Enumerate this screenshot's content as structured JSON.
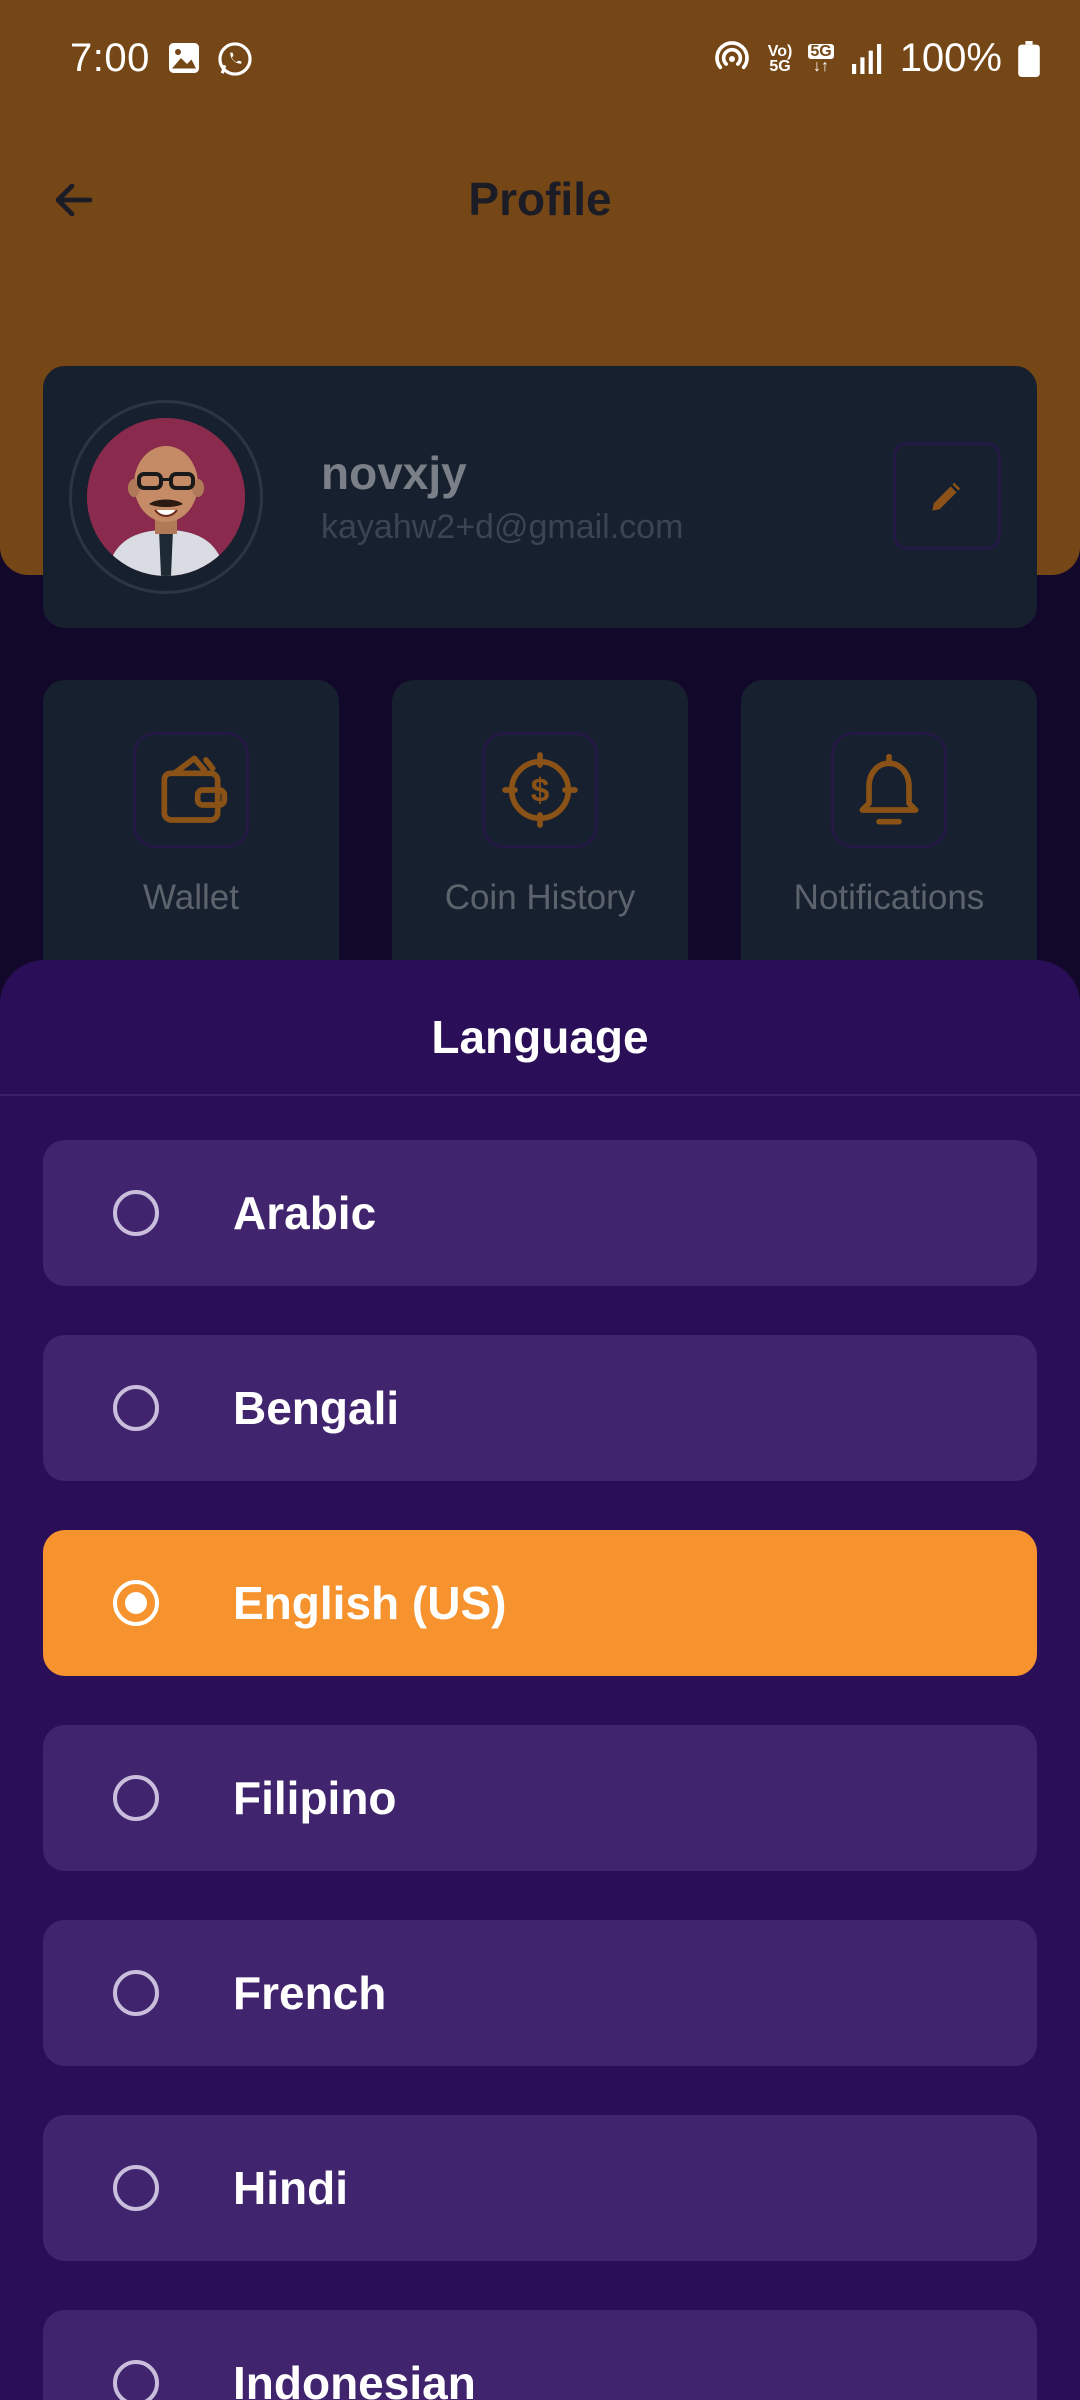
{
  "status_bar": {
    "time": "7:00",
    "battery": "100%",
    "net_top": "Vo)",
    "net_bottom": "5G",
    "badge_5g": "5G"
  },
  "header": {
    "title": "Profile",
    "back_icon": "arrow-left-icon"
  },
  "profile": {
    "username": "novxjy",
    "email": "kayahw2+d@gmail.com",
    "edit_icon": "pencil-icon"
  },
  "quick_actions": [
    {
      "label": "Wallet",
      "icon": "wallet-icon"
    },
    {
      "label": "Coin History",
      "icon": "coin-icon"
    },
    {
      "label": "Notifications",
      "icon": "bell-icon"
    }
  ],
  "language_sheet": {
    "title": "Language",
    "options": [
      {
        "label": "Arabic",
        "selected": false
      },
      {
        "label": "Bengali",
        "selected": false
      },
      {
        "label": "English (US)",
        "selected": true
      },
      {
        "label": "Filipino",
        "selected": false
      },
      {
        "label": "French",
        "selected": false
      },
      {
        "label": "Hindi",
        "selected": false
      },
      {
        "label": "Indonesian",
        "selected": false
      }
    ]
  },
  "colors": {
    "header": "#754716",
    "sheet": "#2a0f58",
    "option": "#40256e",
    "selected_option": "#f7932e",
    "accent_icon": "#8a5216"
  }
}
